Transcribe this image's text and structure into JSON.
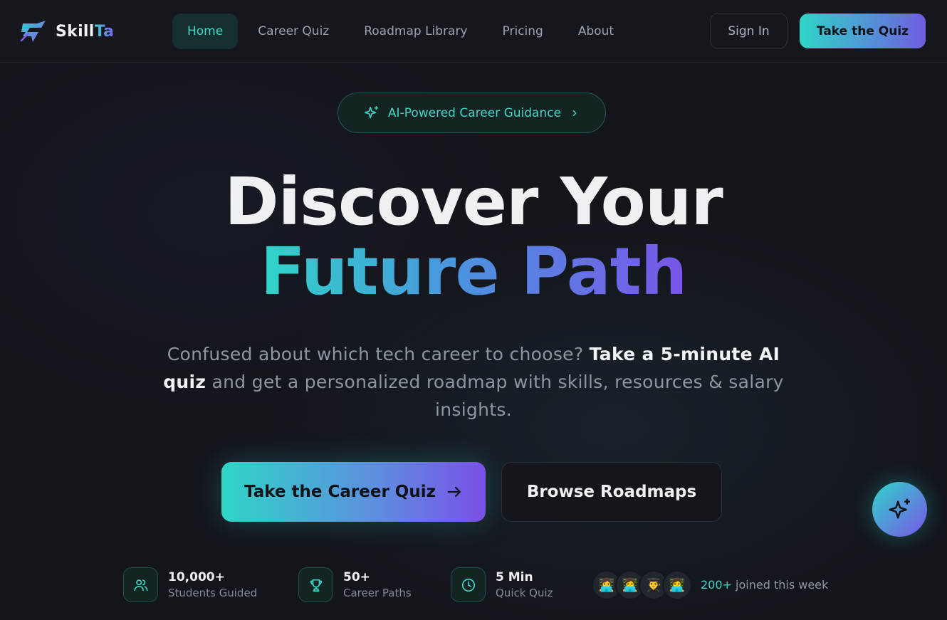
{
  "brand": {
    "name_part1": "Skill",
    "name_part2": "Ta"
  },
  "nav": {
    "items": [
      {
        "label": "Home",
        "active": true
      },
      {
        "label": "Career Quiz",
        "active": false
      },
      {
        "label": "Roadmap Library",
        "active": false
      },
      {
        "label": "Pricing",
        "active": false
      },
      {
        "label": "About",
        "active": false
      }
    ],
    "sign_in": "Sign In",
    "cta": "Take the Quiz"
  },
  "hero": {
    "badge": "AI-Powered Career Guidance",
    "title_line1": "Discover Your",
    "title_line2": "Future Path",
    "subtitle_part1": "Confused about which tech career to choose?",
    "subtitle_bold": "Take a 5-minute AI quiz",
    "subtitle_part2": "and get a personalized roadmap with skills, resources & salary insights.",
    "primary_button": "Take the Career Quiz",
    "secondary_button": "Browse Roadmaps"
  },
  "stats": [
    {
      "value": "10,000+",
      "label": "Students Guided",
      "icon": "users-icon"
    },
    {
      "value": "50+",
      "label": "Career Paths",
      "icon": "trophy-icon"
    },
    {
      "value": "5 Min",
      "label": "Quick Quiz",
      "icon": "clock-icon"
    }
  ],
  "social_proof": {
    "avatars": [
      "👩‍💻",
      "👩‍💻",
      "👨‍🎓",
      "👩‍💻"
    ],
    "count": "200+",
    "text": "joined this week"
  },
  "colors": {
    "accent_teal": "#2fd5c8",
    "accent_purple": "#7a55e8",
    "background": "#13151b"
  }
}
